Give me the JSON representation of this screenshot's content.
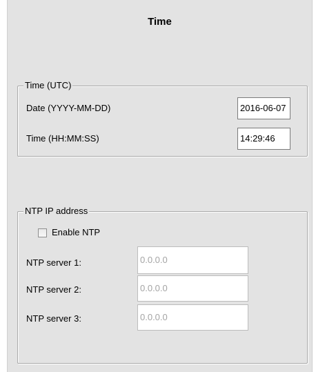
{
  "window": {
    "title": "Time"
  },
  "time_utc_group": {
    "legend": "Time (UTC)",
    "date_label": "Date  (YYYY-MM-DD)",
    "date_value": "2016-06-07",
    "time_label": "Time  (HH:MM:SS)",
    "time_value": "14:29:46"
  },
  "ntp_group": {
    "legend": "NTP IP address",
    "enable_label": "Enable NTP",
    "enable_checked": false,
    "servers": [
      {
        "label": "NTP server 1:",
        "value": "0.0.0.0"
      },
      {
        "label": "NTP server 2:",
        "value": "0.0.0.0"
      },
      {
        "label": "NTP server 3:",
        "value": "0.0.0.0"
      }
    ]
  }
}
